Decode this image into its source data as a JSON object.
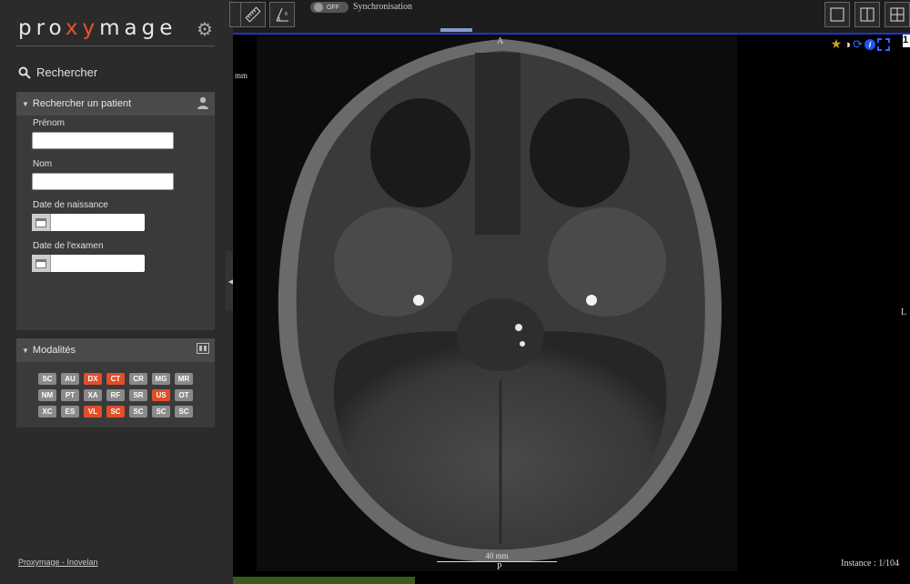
{
  "app": {
    "logo": {
      "a": "pro",
      "b": "xy",
      "c": "mage"
    }
  },
  "sidebar": {
    "search_title": "Rechercher",
    "patient_panel": {
      "title": "Rechercher un patient",
      "fields": {
        "prenom": {
          "label": "Prénom",
          "value": ""
        },
        "nom": {
          "label": "Nom",
          "value": ""
        },
        "naissance": {
          "label": "Date de naissance",
          "value": ""
        },
        "examen": {
          "label": "Date de l'examen",
          "value": ""
        }
      }
    },
    "modalities_panel": {
      "title": "Modalités",
      "items": [
        {
          "label": "SC",
          "active": false
        },
        {
          "label": "AU",
          "active": false
        },
        {
          "label": "DX",
          "active": true
        },
        {
          "label": "CT",
          "active": true
        },
        {
          "label": "CR",
          "active": false
        },
        {
          "label": "MG",
          "active": false
        },
        {
          "label": "MR",
          "active": false
        },
        {
          "label": "NM",
          "active": false
        },
        {
          "label": "PT",
          "active": false
        },
        {
          "label": "XA",
          "active": false
        },
        {
          "label": "RF",
          "active": false
        },
        {
          "label": "SR",
          "active": false
        },
        {
          "label": "US",
          "active": true
        },
        {
          "label": "OT",
          "active": false
        },
        {
          "label": "XC",
          "active": false
        },
        {
          "label": "ES",
          "active": false
        },
        {
          "label": "VL",
          "active": true
        },
        {
          "label": "SC",
          "active": true
        },
        {
          "label": "SC",
          "active": false
        },
        {
          "label": "SC",
          "active": false
        },
        {
          "label": "SC",
          "active": false
        }
      ]
    },
    "footer_link": "Proxymage - Inovelan"
  },
  "toolbar": {
    "sync_toggle": "OFF",
    "sync_label": "Synchronisation"
  },
  "viewer": {
    "orient_top": "A",
    "orient_bottom": "P",
    "orient_right": "L",
    "unit_label": "mm",
    "scale_label": "40 mm",
    "instance": "Instance : 1/104",
    "corner_number": "1"
  },
  "colors": {
    "accent": "#e14e2a",
    "toolbar_border": "#2233cc"
  }
}
